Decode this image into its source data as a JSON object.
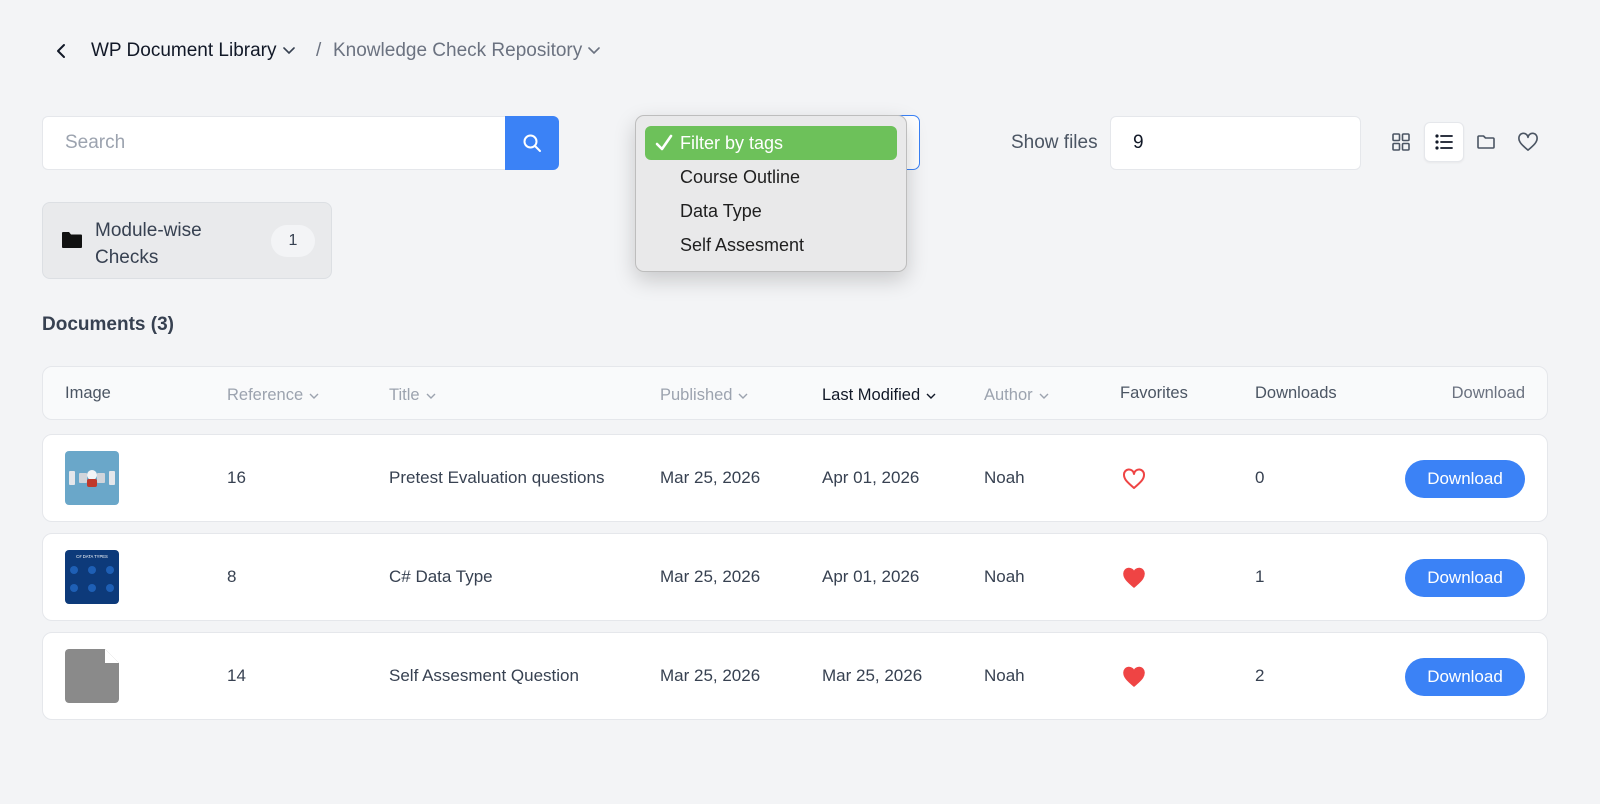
{
  "breadcrumb": {
    "root": "WP Document Library",
    "separator": "/",
    "current": "Knowledge Check Repository"
  },
  "search": {
    "placeholder": "Search",
    "value": ""
  },
  "tag_filter": {
    "options": [
      {
        "label": "Filter by tags",
        "selected": true
      },
      {
        "label": "Course Outline",
        "selected": false
      },
      {
        "label": "Data Type",
        "selected": false
      },
      {
        "label": "Self Assesment",
        "selected": false
      }
    ]
  },
  "show_files": {
    "label": "Show files",
    "value": "9"
  },
  "views": [
    "grid-icon",
    "list-icon",
    "folder-icon",
    "heart-icon"
  ],
  "folder": {
    "name": "Module-wise Checks",
    "count": "1"
  },
  "documents_heading": "Documents (3)",
  "table": {
    "columns": {
      "image": "Image",
      "reference": "Reference",
      "title": "Title",
      "published": "Published",
      "last_modified": "Last Modified",
      "author": "Author",
      "favorites": "Favorites",
      "downloads": "Downloads",
      "download": "Download"
    },
    "rows": [
      {
        "reference": "16",
        "title": "Pretest Evaluation questions",
        "published": "Mar 25, 2026",
        "last_modified": "Apr 01, 2026",
        "author": "Noah",
        "favorite": false,
        "downloads": "0",
        "button": "Download",
        "thumb": "pretest-thumbnail"
      },
      {
        "reference": "8",
        "title": "C# Data Type",
        "published": "Mar 25, 2026",
        "last_modified": "Apr 01, 2026",
        "author": "Noah",
        "favorite": true,
        "downloads": "1",
        "button": "Download",
        "thumb": "csharp-data-types-thumbnail",
        "thumb_text": "C# DATA TYPES"
      },
      {
        "reference": "14",
        "title": "Self Assesment Question",
        "published": "Mar 25, 2026",
        "last_modified": "Mar 25, 2026",
        "author": "Noah",
        "favorite": true,
        "downloads": "2",
        "button": "Download",
        "thumb": "generic-file-thumbnail"
      }
    ]
  },
  "colors": {
    "accent": "#3b82f6",
    "selected_tag": "#6dc15a",
    "favorite": "#ef4444"
  }
}
